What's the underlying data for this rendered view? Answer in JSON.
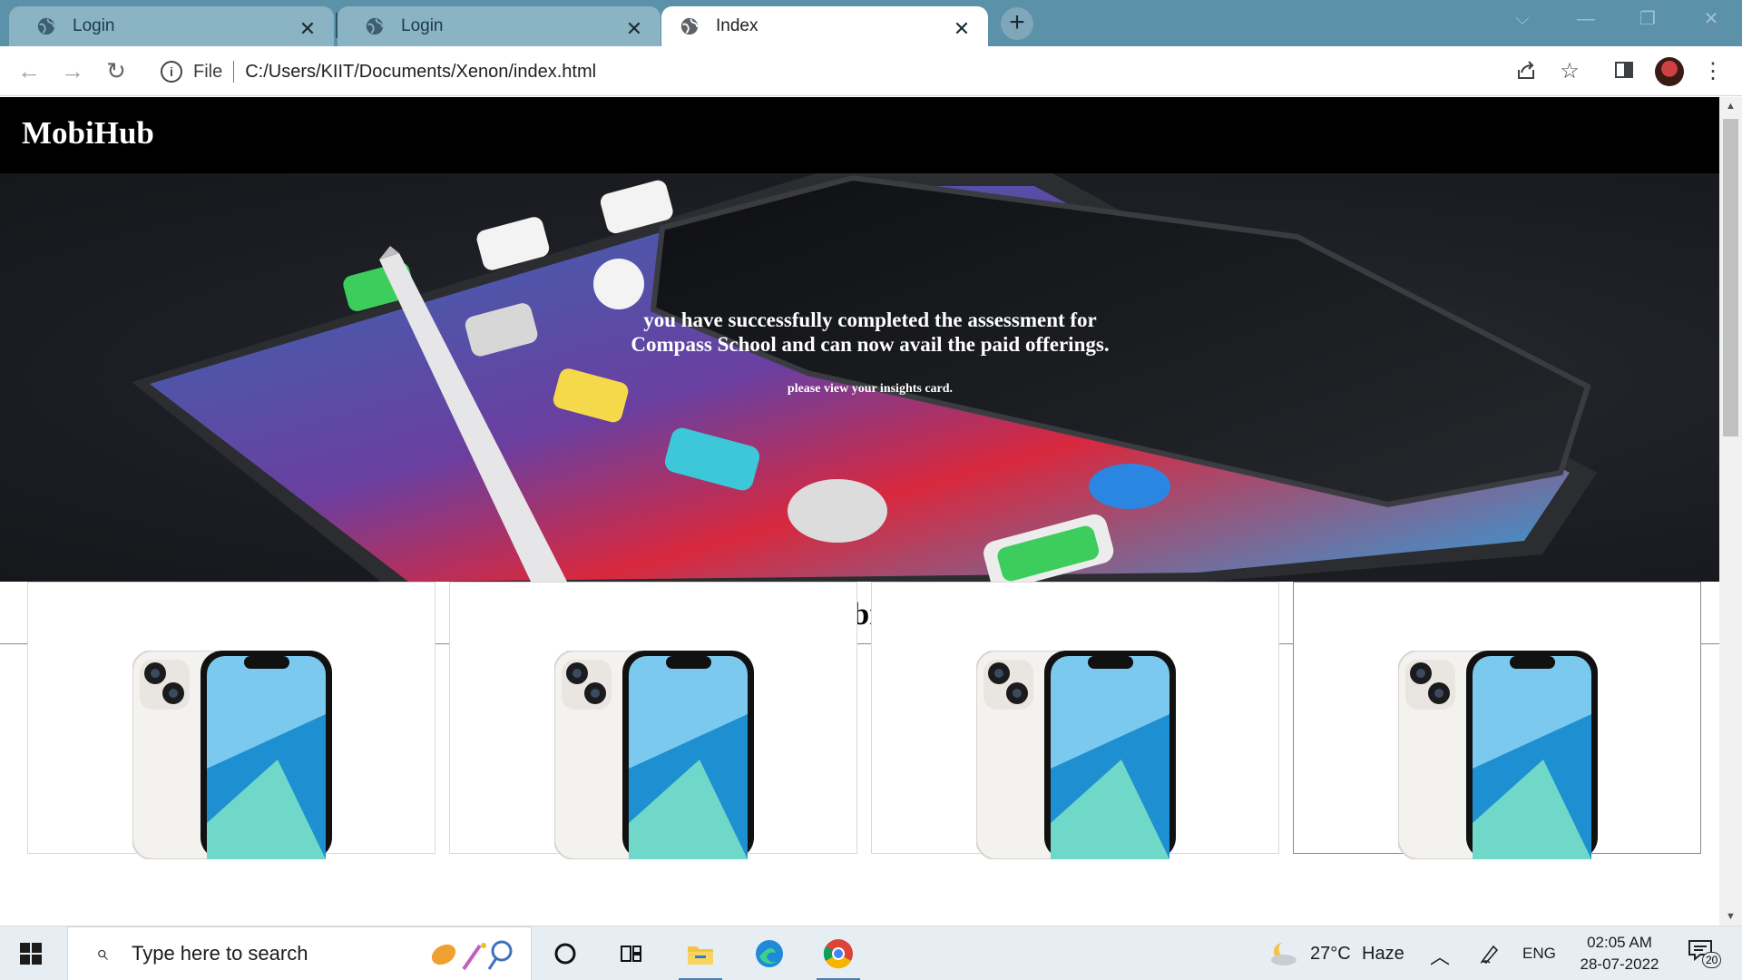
{
  "browser": {
    "tabs": [
      {
        "title": "Login",
        "active": false
      },
      {
        "title": "Login",
        "active": false
      },
      {
        "title": "Index",
        "active": true
      }
    ],
    "close_glyph": "✕",
    "new_tab_glyph": "+",
    "window_controls": {
      "dropdown": "⌵",
      "minimize": "—",
      "restore": "❐",
      "close": "✕"
    },
    "nav": {
      "back": "←",
      "forward": "→",
      "reload": "↻"
    },
    "address": {
      "info_glyph": "i",
      "scheme_label": "File",
      "url": "C:/Users/KIIT/Documents/Xenon/index.html"
    },
    "toolbar_icons": [
      "share-icon",
      "bookmark-star-icon",
      "side-panel-icon",
      "profile-avatar"
    ]
  },
  "page": {
    "brand": "MobiHub",
    "hero": {
      "line1": "you have successfully completed the assessment for",
      "line2": "Compass School and can now avail the paid offerings.",
      "sub": "please view your insights card."
    },
    "section_title": "Mobiles",
    "products": [
      {
        "image": "iphone-13-starlight"
      },
      {
        "image": "iphone-13-starlight"
      },
      {
        "image": "iphone-13-starlight"
      },
      {
        "image": "iphone-13-starlight"
      }
    ]
  },
  "taskbar": {
    "search_placeholder": "Type here to search",
    "weather": {
      "temp": "27°C",
      "condition": "Haze"
    },
    "language": "ENG",
    "time": "02:05 AM",
    "date": "28-07-2022",
    "notifications": "20"
  },
  "colors": {
    "tabbar": "#5b91a9",
    "header": "#000000",
    "accent_taskbar": "#4a7fb0"
  }
}
